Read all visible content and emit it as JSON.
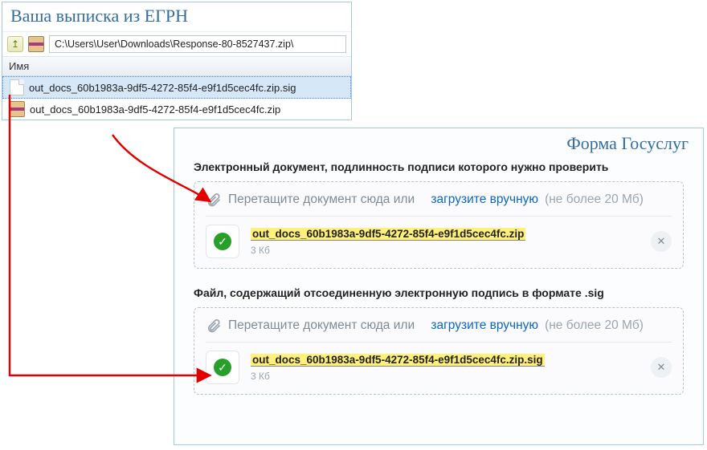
{
  "egrn": {
    "title": "Ваша выписка из ЕГРН",
    "path": "C:\\Users\\User\\Downloads\\Response-80-8527437.zip\\",
    "header": "Имя",
    "files": [
      "out_docs_60b1983a-9df5-4272-85f4-e9f1d5cec4fc.zip.sig",
      "out_docs_60b1983a-9df5-4272-85f4-e9f1d5cec4fc.zip"
    ]
  },
  "svc": {
    "title": "Форма Госуслуг",
    "section1_label": "Электронный документ, подлинность подписи которого нужно проверить",
    "section2_label": "Файл, содержащий отсоединенную электронную подпись в формате .sig",
    "drop_text": "Перетащите документ сюда или",
    "drop_link": "загрузите вручную",
    "drop_size": "(не более 20 Мб)",
    "file1": {
      "name": "out_docs_60b1983a-9df5-4272-85f4-e9f1d5cec4fc.zip",
      "size": "3 Кб"
    },
    "file2": {
      "name": "out_docs_60b1983a-9df5-4272-85f4-e9f1d5cec4fc.zip.sig",
      "size": "3 Кб"
    }
  }
}
